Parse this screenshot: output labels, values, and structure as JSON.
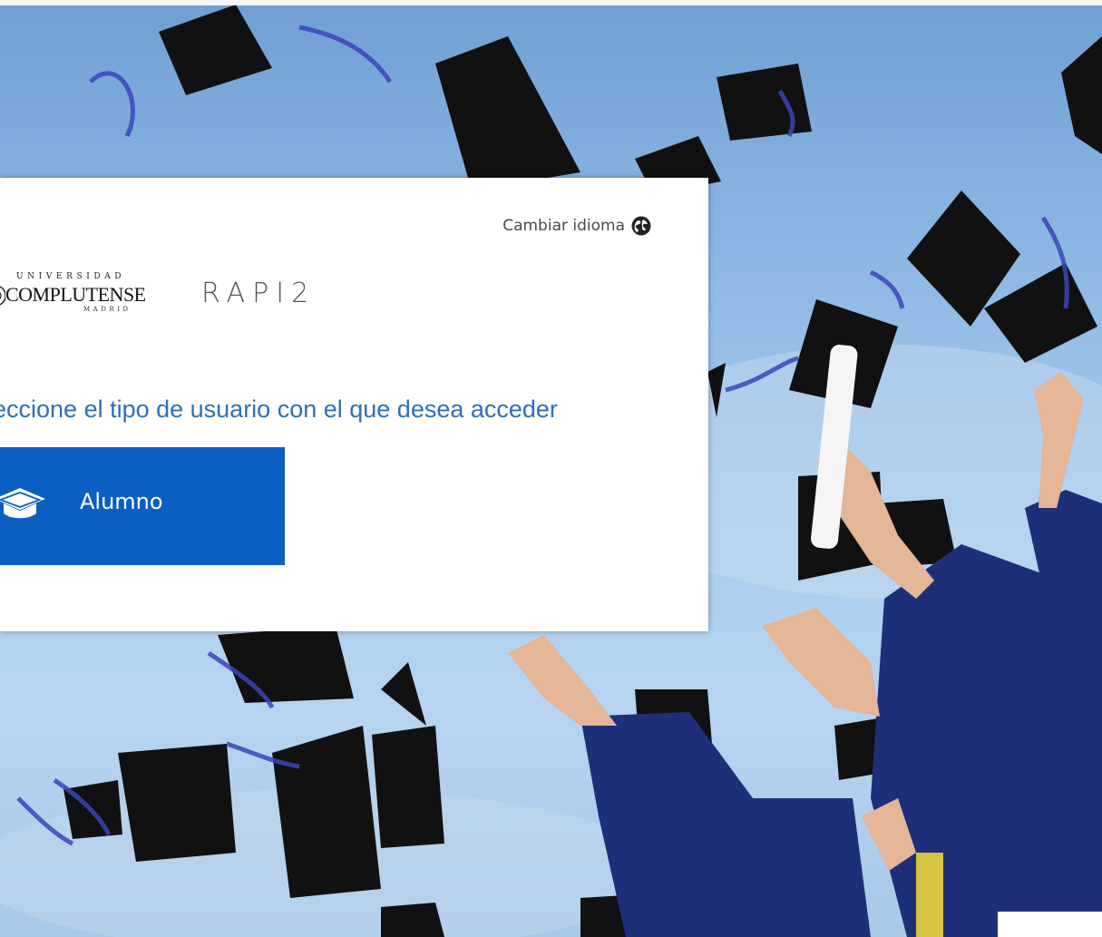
{
  "header": {
    "language_label": "Cambiar idioma",
    "language_icon": "globe-icon"
  },
  "logo": {
    "top": "UNIVERSIDAD",
    "main": "COMPLUTENSE",
    "bottom": "MADRID"
  },
  "app": {
    "name": "RAPI2"
  },
  "main": {
    "prompt": "leccione el tipo de usuario con el que desea acceder",
    "options": [
      {
        "label": "Alumno",
        "icon": "graduation-cap-icon"
      }
    ]
  },
  "colors": {
    "accent": "#0a5fc0",
    "prompt_text": "#2f6fb8",
    "sky": "#a8cbee"
  }
}
